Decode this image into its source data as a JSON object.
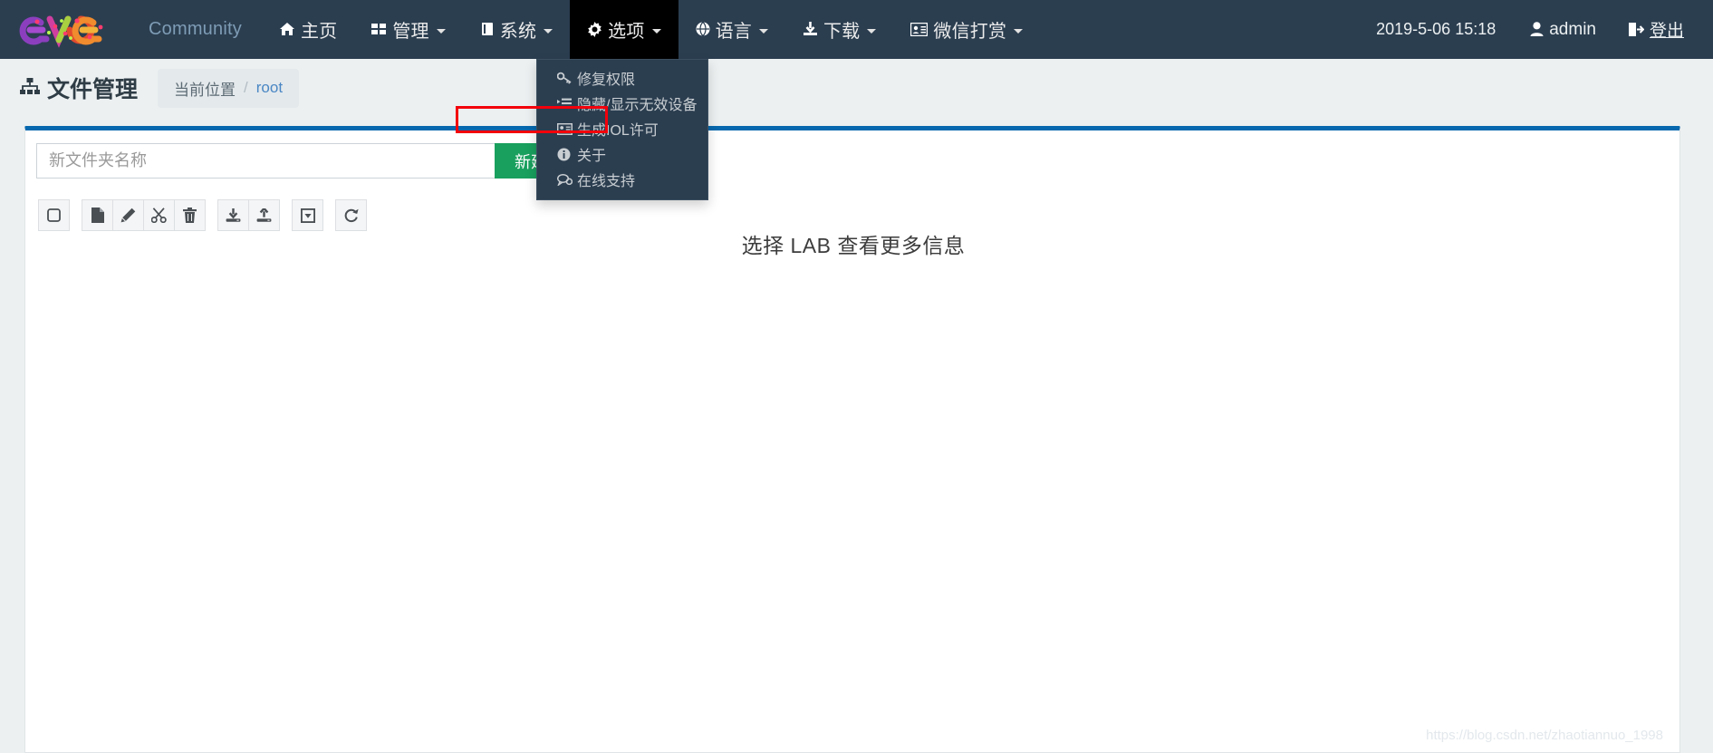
{
  "navbar": {
    "brand_icon": "eve-ng-logo",
    "items": [
      {
        "label": "Community",
        "icon": "",
        "caret": false,
        "name": "nav-community"
      },
      {
        "label": "主页",
        "icon": "home-icon",
        "caret": false,
        "name": "nav-home"
      },
      {
        "label": "管理",
        "icon": "grid-icon",
        "caret": true,
        "name": "nav-management"
      },
      {
        "label": "系统",
        "icon": "book-icon",
        "caret": true,
        "name": "nav-system"
      },
      {
        "label": "选项",
        "icon": "gear-icon",
        "caret": true,
        "name": "nav-options"
      },
      {
        "label": "语言",
        "icon": "globe-icon",
        "caret": true,
        "name": "nav-language"
      },
      {
        "label": "下载",
        "icon": "download-icon",
        "caret": true,
        "name": "nav-download"
      },
      {
        "label": "微信打赏",
        "icon": "card-icon",
        "caret": true,
        "name": "nav-wechat-reward"
      }
    ],
    "clock": "2019-5-06  15:18",
    "user": "admin",
    "user_icon": "user-icon",
    "logout": "登出",
    "logout_icon": "logout-icon"
  },
  "options_menu": {
    "open": true,
    "items": [
      {
        "label": "修复权限",
        "icon": "key-icon"
      },
      {
        "label": "隐藏/显示无效设备",
        "icon": "list-icon"
      },
      {
        "label": "生成IOL许可",
        "icon": "id-card-icon",
        "highlighted": true
      },
      {
        "label": "关于",
        "icon": "info-icon"
      },
      {
        "label": "在线支持",
        "icon": "comments-icon"
      }
    ],
    "highlight_color": "#f3000b"
  },
  "subheader": {
    "title": "文件管理",
    "title_icon": "sitemap-icon",
    "breadcrumb_label": "当前位置",
    "breadcrumb_separator": "/",
    "breadcrumb_current": "root"
  },
  "panel": {
    "accent_color": "#0668ae",
    "new_folder_placeholder": "新文件夹名称",
    "new_folder_value": "",
    "new_folder_button": "新建文件夹",
    "new_folder_button_color": "#19a05e",
    "toolbar": [
      {
        "name": "select-all-checkbox-button",
        "icon": "square-icon"
      },
      {
        "name": "new-file-button",
        "icon": "file-icon"
      },
      {
        "name": "edit-button",
        "icon": "pencil-icon"
      },
      {
        "name": "cut-button",
        "icon": "scissors-icon"
      },
      {
        "name": "delete-button",
        "icon": "trash-icon"
      },
      {
        "name": "download-button",
        "icon": "download-tray-icon"
      },
      {
        "name": "upload-button",
        "icon": "upload-tray-icon"
      },
      {
        "name": "collapse-button",
        "icon": "caret-square-down-icon"
      },
      {
        "name": "refresh-button",
        "icon": "refresh-icon"
      }
    ],
    "empty_hint": "选择 LAB 查看更多信息"
  },
  "watermark": "https://blog.csdn.net/zhaotiannuo_1998"
}
